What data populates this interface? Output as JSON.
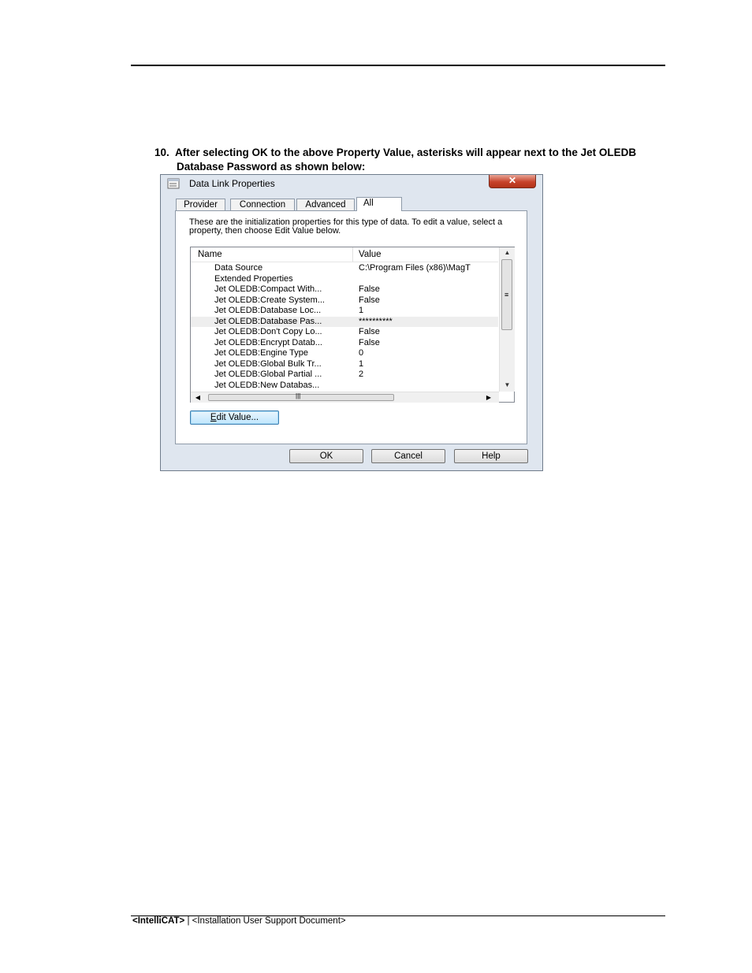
{
  "document": {
    "step_number": "10.",
    "step_line1": "After selecting OK to the above Property Value, asterisks will appear next to the Jet OLEDB",
    "step_line2": "Database Password as shown below:",
    "footer_product": "<IntelliCAT>",
    "footer_sep": " | ",
    "footer_doc": "<Installation User Support Document>"
  },
  "dialog": {
    "title": "Data Link Properties",
    "close_symbol": "✕",
    "tabs": [
      "Provider",
      "Connection",
      "Advanced",
      "All"
    ],
    "active_tab": "All",
    "description": "These are the initialization properties for this type of data. To edit a value, select a property, then choose Edit Value below.",
    "columns": {
      "name": "Name",
      "value": "Value"
    },
    "rows": [
      {
        "name": "Data Source",
        "value": "C:\\Program Files (x86)\\MagT"
      },
      {
        "name": "Extended Properties",
        "value": ""
      },
      {
        "name": "Jet OLEDB:Compact With...",
        "value": "False"
      },
      {
        "name": "Jet OLEDB:Create System...",
        "value": "False"
      },
      {
        "name": "Jet OLEDB:Database Loc...",
        "value": "1"
      },
      {
        "name": "Jet OLEDB:Database Pas...",
        "value": "**********"
      },
      {
        "name": "Jet OLEDB:Don't Copy Lo...",
        "value": "False"
      },
      {
        "name": "Jet OLEDB:Encrypt Datab...",
        "value": "False"
      },
      {
        "name": "Jet OLEDB:Engine Type",
        "value": "0"
      },
      {
        "name": "Jet OLEDB:Global Bulk Tr...",
        "value": "1"
      },
      {
        "name": "Jet OLEDB:Global Partial ...",
        "value": "2"
      },
      {
        "name": "Jet OLEDB:New Databas...",
        "value": ""
      }
    ],
    "selected_row": "Jet OLEDB:Database Pas...",
    "edit_value_button": {
      "mnemonic": "E",
      "rest": "dit Value..."
    },
    "buttons": {
      "ok": "OK",
      "cancel": "Cancel",
      "help": "Help"
    }
  }
}
